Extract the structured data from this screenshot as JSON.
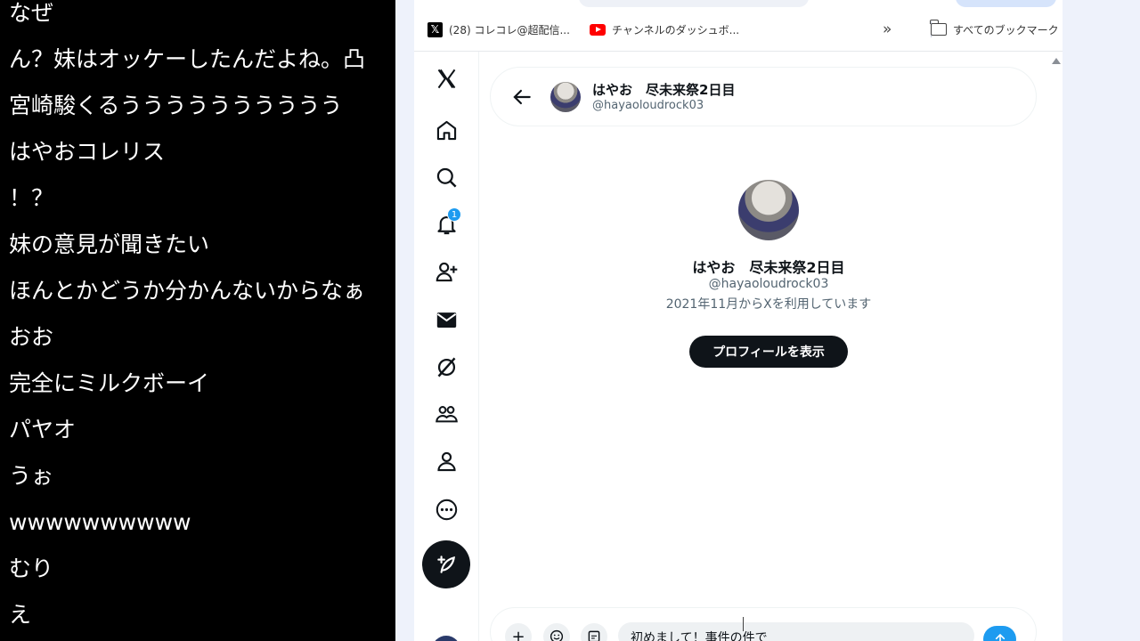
{
  "comments": [
    "なぜ",
    "ん？妹はオッケーしたんだよね。凸",
    "宮崎駿くるうううううううううう",
    "はやおコレリス",
    "！？",
    "妹の意見が聞きたい",
    "ほんとかどうか分かんないからなぁ",
    "おお",
    "完全にミルクボーイ",
    "パヤオ",
    "うぉ",
    "wwwwwwwwww",
    "むり",
    "え"
  ],
  "bookmarks": {
    "items": [
      {
        "label": "(28) コレコレ@超配信...",
        "icon": "x-logo-icon"
      },
      {
        "label": "チャンネルのダッシュボ...",
        "icon": "youtube-icon"
      }
    ],
    "overflow_label": "»",
    "all_bookmarks_label": "すべてのブックマーク"
  },
  "nav": {
    "notification_count": "1"
  },
  "conversation": {
    "name": "はやお　尽未来祭2日目",
    "handle": "@hayaoloudrock03"
  },
  "profile": {
    "name": "はやお　尽未来祭2日目",
    "handle": "@hayaoloudrock03",
    "joined": "2021年11月からXを利用しています",
    "button_label": "プロフィールを表示"
  },
  "composer": {
    "add_label": "+",
    "message": "初めまして！事件の件で"
  },
  "colors": {
    "accent": "#1d9bf0",
    "primary_text": "#0f1419",
    "secondary_text": "#536471",
    "comment_bg": "#000000"
  }
}
